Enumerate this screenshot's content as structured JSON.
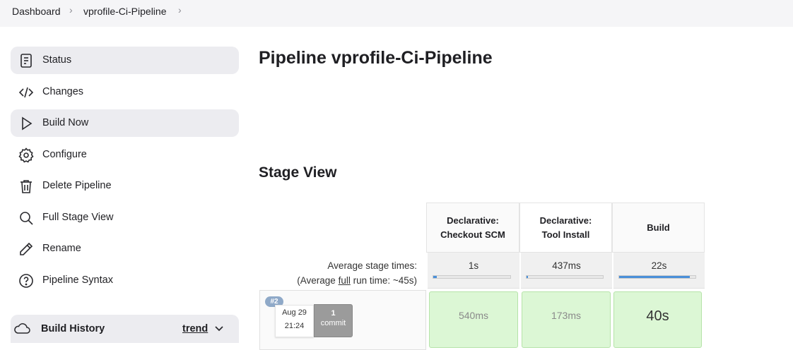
{
  "breadcrumb": {
    "items": [
      "Dashboard",
      "vprofile-Ci-Pipeline"
    ],
    "separator": ">"
  },
  "sidebar": {
    "items": [
      {
        "label": "Status",
        "icon": "document-icon",
        "active": true
      },
      {
        "label": "Changes",
        "icon": "code-icon",
        "active": false
      },
      {
        "label": "Build Now",
        "icon": "play-icon",
        "active": true
      },
      {
        "label": "Configure",
        "icon": "gear-icon",
        "active": false
      },
      {
        "label": "Delete Pipeline",
        "icon": "trash-icon",
        "active": false
      },
      {
        "label": "Full Stage View",
        "icon": "search-icon",
        "active": false
      },
      {
        "label": "Rename",
        "icon": "pencil-icon",
        "active": false
      },
      {
        "label": "Pipeline Syntax",
        "icon": "help-icon",
        "active": false
      }
    ],
    "build_history": {
      "label": "Build History",
      "trend": "trend",
      "icon": "cloud-icon"
    }
  },
  "main": {
    "title": "Pipeline vprofile-Ci-Pipeline",
    "stage_view_title": "Stage View"
  },
  "stage_view": {
    "stages": [
      {
        "line1": "Declarative:",
        "line2": "Checkout SCM",
        "avg": "1s",
        "avg_fraction": 0.05
      },
      {
        "line1": "Declarative:",
        "line2": "Tool Install",
        "avg": "437ms",
        "avg_fraction": 0.02
      },
      {
        "line1": "",
        "line2": "Build",
        "avg": "22s",
        "avg_fraction": 0.93
      }
    ],
    "avg_label_line1": "Average stage times:",
    "avg_label_prefix": "(Average ",
    "avg_label_link": "full",
    "avg_label_suffix": " run time: ~45s)",
    "run": {
      "badge": "#2",
      "date": "Aug 29",
      "time": "21:24",
      "commit_count": "1",
      "commit_label": "commit",
      "durations": [
        "540ms",
        "173ms",
        "40s"
      ]
    }
  },
  "colors": {
    "success_cell": "#dcf7d5",
    "progress_fill": "#4a90d9",
    "active_bg": "#ececf0",
    "badge": "#8fa9c8"
  }
}
